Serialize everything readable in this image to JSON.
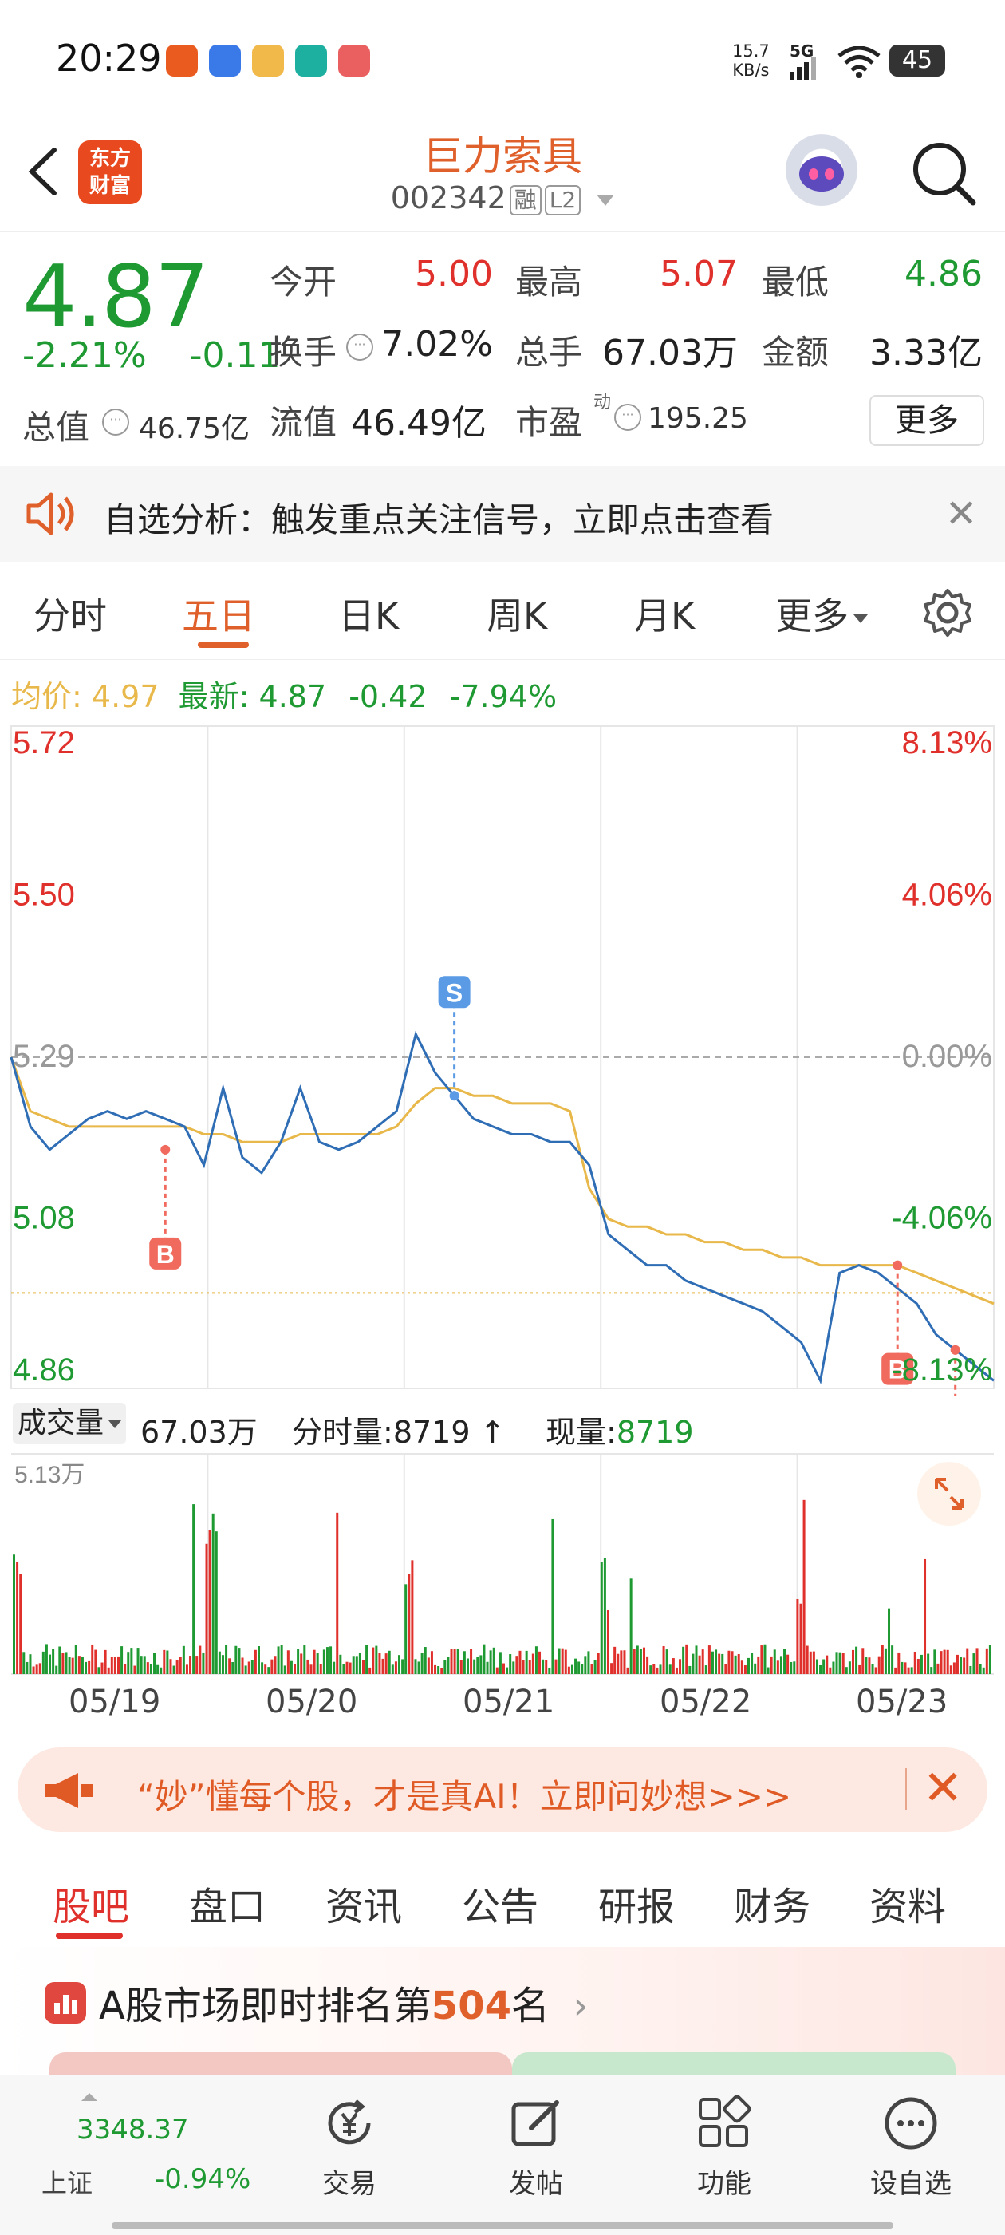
{
  "status": {
    "time": "20:29",
    "net_speed_value": "15.7",
    "net_speed_unit": "KB/s",
    "network": "5G",
    "battery": "45"
  },
  "header": {
    "brand_line1": "东方",
    "brand_line2": "财富",
    "stock_name": "巨力索具",
    "stock_code": "002342",
    "tag_margin": "融",
    "tag_level": "L2"
  },
  "quote": {
    "last_price": "4.87",
    "change_pct": "-2.21%",
    "change_amt": "-0.11",
    "open_label": "今开",
    "open_value": "5.00",
    "high_label": "最高",
    "high_value": "5.07",
    "low_label": "最低",
    "low_value": "4.86",
    "turnover_label": "换手",
    "turnover_value": "7.02%",
    "volume_label": "总手",
    "volume_value": "67.03万",
    "amount_label": "金额",
    "amount_value": "3.33亿",
    "mktcap_label": "总值",
    "mktcap_value": "46.75亿",
    "float_label": "流值",
    "float_value": "46.49亿",
    "pe_label": "市盈",
    "pe_sup": "动",
    "pe_value": "195.25",
    "more_label": "更多"
  },
  "analysis": {
    "text": "自选分析：触发重点关注信号，立即点击查看"
  },
  "period_tabs": [
    "分时",
    "五日",
    "日K",
    "周K",
    "月K",
    "更多"
  ],
  "active_period": "五日",
  "chart_info": {
    "avg_label": "均价:",
    "avg_value": "4.97",
    "latest_label": "最新:",
    "latest_value": "4.87",
    "latest_change": "-0.42",
    "latest_pct": "-7.94%"
  },
  "volume_info": {
    "select_label": "成交量",
    "total": "67.03万",
    "tick_label": "分时量:",
    "tick_value": "8719",
    "tick_arrow": "↑",
    "now_label": "现量:",
    "now_value": "8719",
    "max_label": "5.13万"
  },
  "colors": {
    "up": "#e0302b",
    "down": "#1f9a33",
    "price_line": "#2f6db5",
    "avg_line": "#e8b84a",
    "accent": "#e0602b"
  },
  "chart_data": {
    "type": "line",
    "title": "",
    "ylim": [
      4.86,
      5.72
    ],
    "y_ticks_left": [
      "5.72",
      "5.50",
      "5.29",
      "5.08",
      "4.86"
    ],
    "y_ticks_right": [
      "8.13%",
      "4.06%",
      "0.00%",
      "-4.06%",
      "-8.13%"
    ],
    "prev_close": 5.29,
    "categories": [
      "05/19",
      "05/20",
      "05/21",
      "05/22",
      "05/23"
    ],
    "series": [
      {
        "values": [
          5.29,
          5.2,
          5.17,
          5.19,
          5.21,
          5.22,
          5.21,
          5.22,
          5.21,
          5.2,
          5.15,
          5.25,
          5.16,
          5.14,
          5.18,
          5.25,
          5.18,
          5.17,
          5.18,
          5.2,
          5.22,
          5.32,
          5.27,
          5.24,
          5.21,
          5.2,
          5.19,
          5.19,
          5.18,
          5.18,
          5.15,
          5.06,
          5.04,
          5.02,
          5.02,
          5.0,
          4.99,
          4.98,
          4.97,
          4.96,
          4.94,
          4.92,
          4.87,
          5.01,
          5.02,
          5.01,
          4.99,
          4.97,
          4.93,
          4.91,
          4.89,
          4.87
        ]
      },
      {
        "values": [
          5.29,
          5.22,
          5.21,
          5.2,
          5.2,
          5.2,
          5.2,
          5.2,
          5.2,
          5.2,
          5.19,
          5.19,
          5.18,
          5.18,
          5.18,
          5.19,
          5.19,
          5.19,
          5.19,
          5.19,
          5.2,
          5.23,
          5.25,
          5.25,
          5.24,
          5.24,
          5.23,
          5.23,
          5.23,
          5.22,
          5.12,
          5.08,
          5.07,
          5.07,
          5.06,
          5.06,
          5.05,
          5.05,
          5.04,
          5.04,
          5.03,
          5.03,
          5.02,
          5.02,
          5.02,
          5.02,
          5.02,
          5.01,
          5.0,
          4.99,
          4.98,
          4.97
        ]
      }
    ],
    "markers": [
      {
        "label": "B",
        "index": 8,
        "price": 5.17
      },
      {
        "label": "S",
        "index": 23,
        "price": 5.24
      },
      {
        "label": "B",
        "index": 46,
        "price": 5.02
      },
      {
        "label": "B",
        "index": 49,
        "price": 4.91
      }
    ],
    "grid": true
  },
  "bottom_tabs": [
    "股吧",
    "盘口",
    "资讯",
    "公告",
    "研报",
    "财务",
    "资料"
  ],
  "active_bottom_tab": "股吧",
  "promo": {
    "text": "“妙”懂每个股，才是真AI！立即问妙想>>>"
  },
  "rank": {
    "prefix": "A股市场即时排名第",
    "number": "504",
    "suffix": "名",
    "chevron": "›"
  },
  "nav": {
    "index_value": "3348.37",
    "index_name": "上证",
    "index_change": "-0.94%",
    "items": [
      "交易",
      "发帖",
      "功能",
      "设自选"
    ]
  }
}
